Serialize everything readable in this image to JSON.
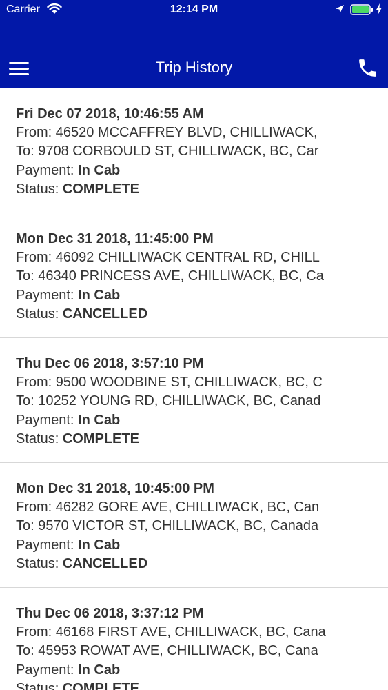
{
  "status_bar": {
    "carrier": "Carrier",
    "time": "12:14 PM",
    "icons": [
      "wifi-icon",
      "location-arrow-icon",
      "battery-icon",
      "charging-bolt-icon"
    ]
  },
  "header": {
    "title": "Trip History",
    "menu_icon": "hamburger-menu-icon",
    "call_icon": "phone-icon",
    "background_color": "#0218a8"
  },
  "labels": {
    "from": "From: ",
    "to": "To: ",
    "payment": "Payment: ",
    "status": "Status: "
  },
  "trips": [
    {
      "date": "Fri Dec 07 2018, 10:46:55 AM",
      "from": "46520 MCCAFFREY BLVD, CHILLIWACK,",
      "to": "9708 CORBOULD ST, CHILLIWACK, BC, Car",
      "payment": "In Cab",
      "status": "COMPLETE"
    },
    {
      "date": "Mon Dec 31 2018, 11:45:00 PM",
      "from": "46092 CHILLIWACK CENTRAL RD, CHILL",
      "to": "46340 PRINCESS AVE, CHILLIWACK, BC, Ca",
      "payment": "In Cab",
      "status": "CANCELLED"
    },
    {
      "date": "Thu Dec 06 2018, 3:57:10 PM",
      "from": "9500 WOODBINE ST, CHILLIWACK, BC, C",
      "to": "10252 YOUNG RD, CHILLIWACK, BC, Canad",
      "payment": "In Cab",
      "status": "COMPLETE"
    },
    {
      "date": "Mon Dec 31 2018, 10:45:00 PM",
      "from": "46282 GORE AVE, CHILLIWACK, BC, Can",
      "to": "9570 VICTOR ST, CHILLIWACK, BC, Canada",
      "payment": "In Cab",
      "status": "CANCELLED"
    },
    {
      "date": "Thu Dec 06 2018, 3:37:12 PM",
      "from": "46168 FIRST AVE, CHILLIWACK, BC, Cana",
      "to": "45953 ROWAT AVE, CHILLIWACK, BC, Cana",
      "payment": "In Cab",
      "status": "COMPLETE"
    }
  ]
}
